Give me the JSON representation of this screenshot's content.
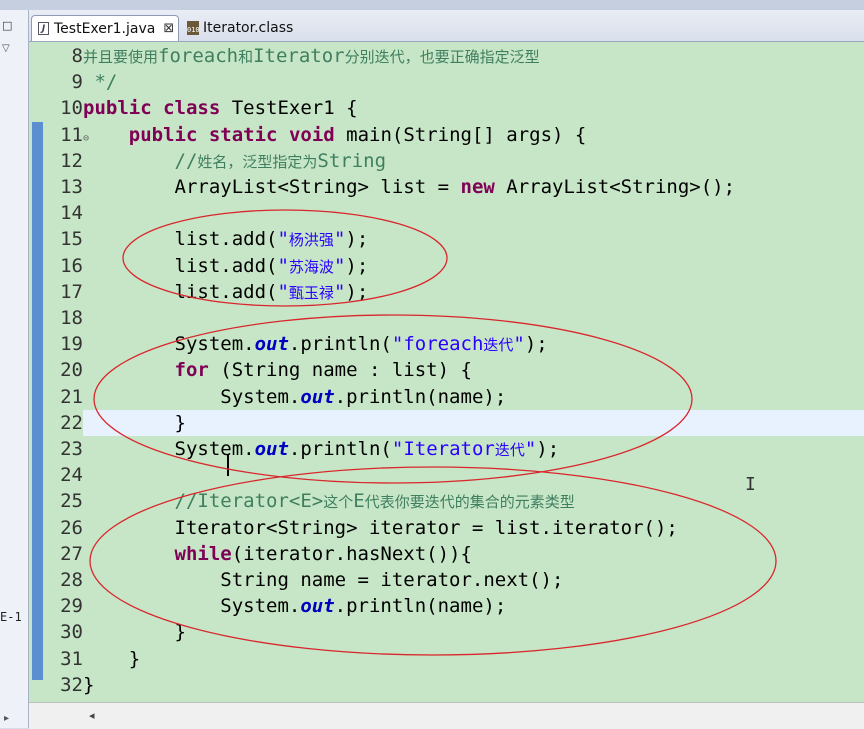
{
  "left_panel": {
    "icon_a": "□",
    "icon_b": "▽",
    "label": "E-1",
    "scroll_arrow": "▸"
  },
  "tabs": [
    {
      "label": "TestExer1.java",
      "icon": "J",
      "close": "⊠"
    },
    {
      "label": "Iterator.class",
      "icon": "010"
    }
  ],
  "lines": [
    {
      "n": "8",
      "parts": [
        {
          "t": "并且要使用",
          "c": "cm cn"
        },
        {
          "t": "foreach",
          "c": "cm"
        },
        {
          "t": "和",
          "c": "cm cn"
        },
        {
          "t": "Iterator",
          "c": "cm"
        },
        {
          "t": "分别迭代，也要正确指定泛型",
          "c": "cm cn"
        }
      ]
    },
    {
      "n": "9",
      "parts": [
        {
          "t": " */",
          "c": "cm"
        }
      ]
    },
    {
      "n": "10",
      "parts": [
        {
          "t": "public",
          "c": "kw"
        },
        {
          "t": " "
        },
        {
          "t": "class",
          "c": "kw"
        },
        {
          "t": " TestExer1 {"
        }
      ]
    },
    {
      "n": "11",
      "fold": "⊖",
      "parts": [
        {
          "t": "    "
        },
        {
          "t": "public",
          "c": "kw"
        },
        {
          "t": " "
        },
        {
          "t": "static",
          "c": "kw"
        },
        {
          "t": " "
        },
        {
          "t": "void",
          "c": "kw"
        },
        {
          "t": " main(String[] args) {"
        }
      ]
    },
    {
      "n": "12",
      "parts": [
        {
          "t": "        //",
          "c": "cm"
        },
        {
          "t": "姓名，泛型指定为",
          "c": "cm cn"
        },
        {
          "t": "String",
          "c": "cm"
        }
      ]
    },
    {
      "n": "13",
      "parts": [
        {
          "t": "        ArrayList<String> list = "
        },
        {
          "t": "new",
          "c": "kw"
        },
        {
          "t": " ArrayList<String>();"
        }
      ]
    },
    {
      "n": "14",
      "parts": [
        {
          "t": ""
        }
      ]
    },
    {
      "n": "15",
      "parts": [
        {
          "t": "        list.add("
        },
        {
          "t": "\"",
          "c": "str"
        },
        {
          "t": "杨洪强",
          "c": "str cn"
        },
        {
          "t": "\"",
          "c": "str"
        },
        {
          "t": ");"
        }
      ]
    },
    {
      "n": "16",
      "parts": [
        {
          "t": "        list.add("
        },
        {
          "t": "\"",
          "c": "str"
        },
        {
          "t": "苏海波",
          "c": "str cn"
        },
        {
          "t": "\"",
          "c": "str"
        },
        {
          "t": ");"
        }
      ]
    },
    {
      "n": "17",
      "parts": [
        {
          "t": "        list.add("
        },
        {
          "t": "\"",
          "c": "str"
        },
        {
          "t": "甄玉禄",
          "c": "str cn"
        },
        {
          "t": "\"",
          "c": "str"
        },
        {
          "t": ");"
        }
      ]
    },
    {
      "n": "18",
      "parts": [
        {
          "t": ""
        }
      ]
    },
    {
      "n": "19",
      "parts": [
        {
          "t": "        System."
        },
        {
          "t": "out",
          "c": "fld"
        },
        {
          "t": ".println("
        },
        {
          "t": "\"foreach",
          "c": "str"
        },
        {
          "t": "迭代",
          "c": "str cn"
        },
        {
          "t": "\"",
          "c": "str"
        },
        {
          "t": ");"
        }
      ]
    },
    {
      "n": "20",
      "parts": [
        {
          "t": "        "
        },
        {
          "t": "for",
          "c": "kw"
        },
        {
          "t": " (String name : list) {"
        }
      ]
    },
    {
      "n": "21",
      "parts": [
        {
          "t": "            System."
        },
        {
          "t": "out",
          "c": "fld"
        },
        {
          "t": ".println(name);"
        }
      ]
    },
    {
      "n": "22",
      "parts": [
        {
          "t": "        }"
        }
      ]
    },
    {
      "n": "23",
      "parts": [
        {
          "t": "        System."
        },
        {
          "t": "out",
          "c": "fld"
        },
        {
          "t": ".println("
        },
        {
          "t": "\"Iterator",
          "c": "str"
        },
        {
          "t": "迭代",
          "c": "str cn"
        },
        {
          "t": "\"",
          "c": "str"
        },
        {
          "t": ");"
        }
      ]
    },
    {
      "n": "24",
      "parts": [
        {
          "t": ""
        }
      ]
    },
    {
      "n": "25",
      "parts": [
        {
          "t": "        //Iterator<E>",
          "c": "cm"
        },
        {
          "t": "这个",
          "c": "cm cn"
        },
        {
          "t": "E",
          "c": "cm"
        },
        {
          "t": "代表你要迭代的集合的元素类型",
          "c": "cm cn"
        }
      ]
    },
    {
      "n": "26",
      "parts": [
        {
          "t": "        Iterator<String> iterator = list.iterator();"
        }
      ]
    },
    {
      "n": "27",
      "parts": [
        {
          "t": "        "
        },
        {
          "t": "while",
          "c": "kw"
        },
        {
          "t": "(iterator.hasNext()){"
        }
      ]
    },
    {
      "n": "28",
      "parts": [
        {
          "t": "            String name = iterator.next();"
        }
      ]
    },
    {
      "n": "29",
      "parts": [
        {
          "t": "            System."
        },
        {
          "t": "out",
          "c": "fld"
        },
        {
          "t": ".println(name);"
        }
      ]
    },
    {
      "n": "30",
      "parts": [
        {
          "t": "        }"
        }
      ]
    },
    {
      "n": "31",
      "parts": [
        {
          "t": "    }"
        }
      ]
    },
    {
      "n": "32",
      "parts": [
        {
          "t": "}"
        }
      ]
    }
  ],
  "scrollbar": {
    "arrow": "◂"
  },
  "colors": {
    "editor_bg": "#c7e6c7",
    "keyword": "#7f0055",
    "string": "#2a00ff",
    "comment": "#3f7f5f",
    "field": "#0000c0",
    "annotation_ellipse": "#d9262c"
  }
}
